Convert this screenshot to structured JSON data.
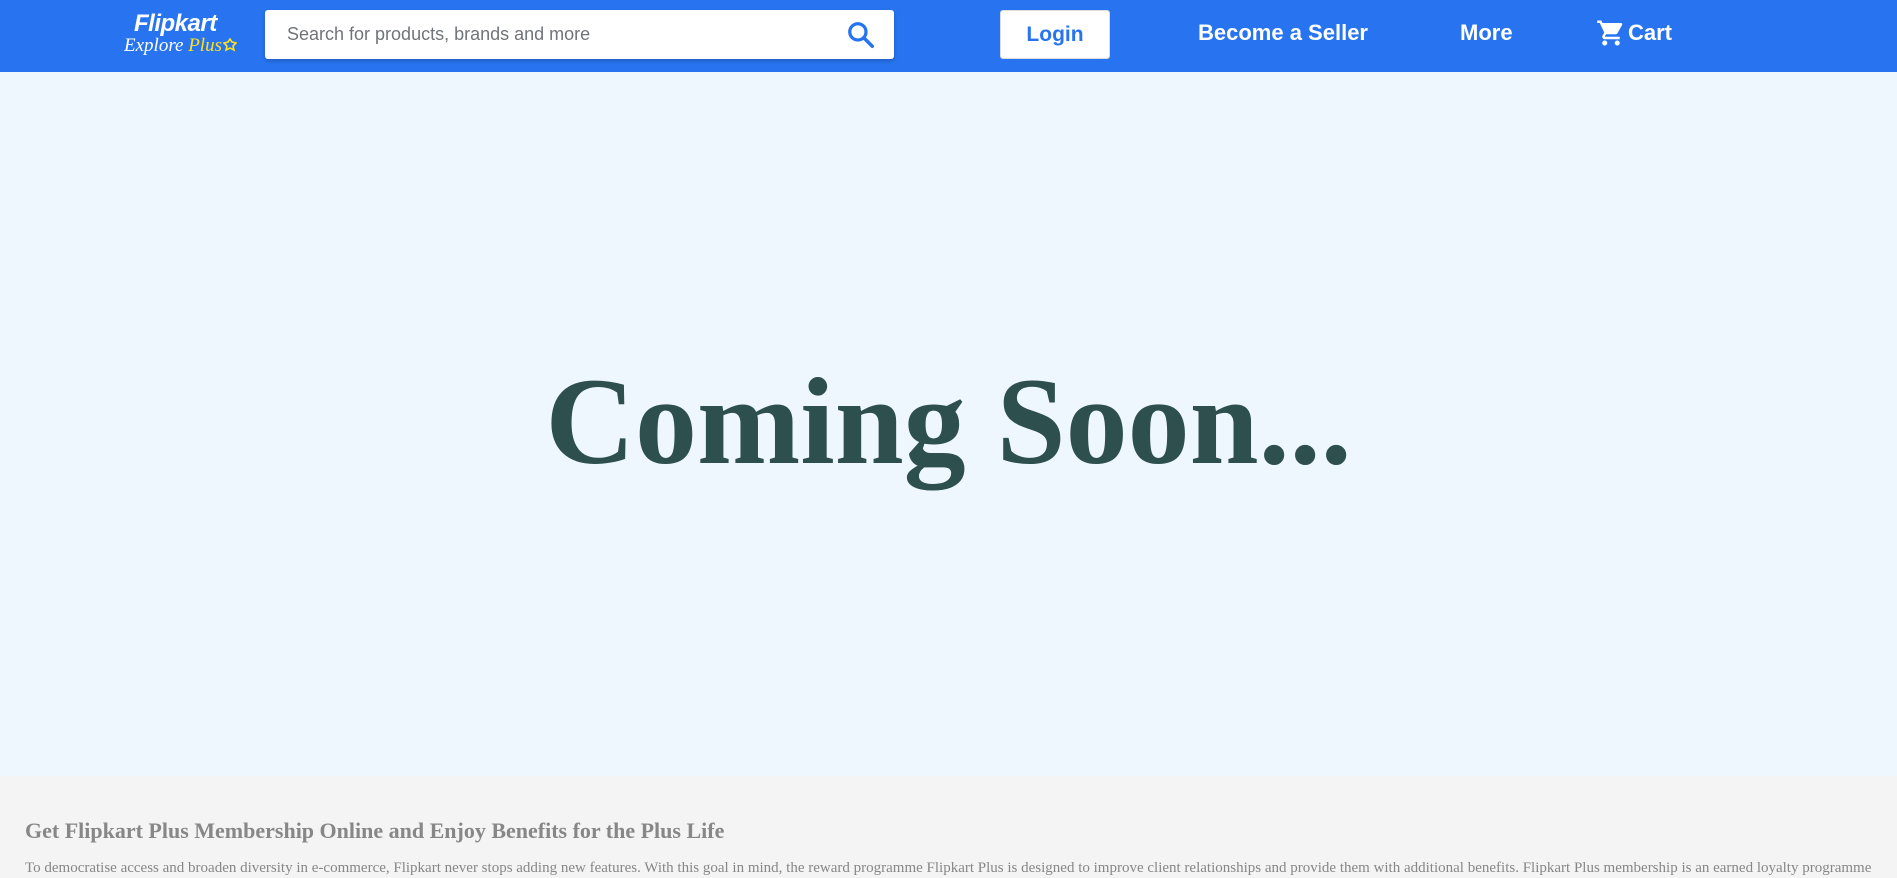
{
  "header": {
    "logo_main": "Flipkart",
    "logo_sub_explore": "Explore",
    "logo_sub_plus": "Plus",
    "search_placeholder": "Search for products, brands and more",
    "search_icon": "search-icon",
    "login_label": "Login",
    "seller_label": "Become a Seller",
    "more_label": "More",
    "cart_label": "Cart",
    "cart_icon": "cart-icon"
  },
  "hero": {
    "heading": "Coming Soon..."
  },
  "footer": {
    "title": "Get Flipkart Plus Membership Online and Enjoy Benefits for the Plus Life",
    "text": "To democratise access and broaden diversity in e-commerce, Flipkart never stops adding new features. With this goal in mind, the reward programme Flipkart Plus is designed to improve client relationships and provide them with additional benefits. Flipkart Plus membership is an earned loyalty programme"
  },
  "colors": {
    "header_bg": "#2874f0",
    "hero_bg": "#eef6fe",
    "heading": "#2d4f4d",
    "plus_accent": "#ffe11b",
    "footer_bg": "#f4f4f4",
    "footer_text": "#878787"
  }
}
